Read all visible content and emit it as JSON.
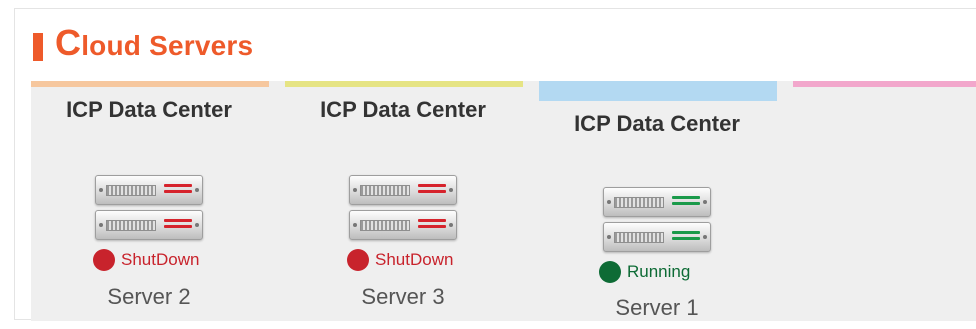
{
  "header": {
    "title_first_letter": "C",
    "title_rest": "loud Servers"
  },
  "colors": {
    "accent": "#ee5a2a",
    "tab_orange": "#f6c79e",
    "tab_yellow": "#e6e484",
    "tab_blue": "#b3d9f2",
    "tab_pink": "#f2a7cc",
    "shutdown": "#c8232c",
    "running": "#0d6b35"
  },
  "data_centers": [
    {
      "label": "ICP Data Center",
      "server": "Server 2",
      "status": "ShutDown",
      "status_icon": "red-status-dot-icon"
    },
    {
      "label": "ICP Data Center",
      "server": "Server 3",
      "status": "ShutDown",
      "status_icon": "red-status-dot-icon"
    },
    {
      "label": "ICP Data Center",
      "server": "Server 1",
      "status": "Running",
      "status_icon": "green-status-dot-icon"
    }
  ]
}
